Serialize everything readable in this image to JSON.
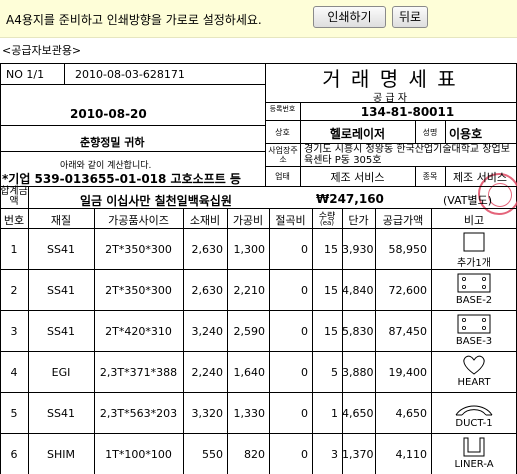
{
  "banner": {
    "message": "A4용지를 준비하고 인쇄방향을 가로로 설정하세요.",
    "print_button": "인쇄하기",
    "back_button": "뒤로"
  },
  "copy_label": "<공급자보관용>",
  "header": {
    "no": "NO 1/1",
    "doc_number": "2010-08-03-628171",
    "title": "거 래 명 세 표",
    "date": "2010-08-20",
    "recipient": "춘향정밀 귀하",
    "calc_notice": "아래와 같이 계산합니다.",
    "bank_account": "*기업 539-013655-01-018 고호소프트 등",
    "supplier_label": "공 급 자",
    "reg_label": "등록번호",
    "reg_number": "134-81-80011",
    "company_label": "상호",
    "company_name": "헬로레이저",
    "ceo_label": "성명",
    "ceo_name": "이용호",
    "address_label": "사업장주소",
    "address": "경기도 시흥시 정왕동 한국산업기술대학교 창업보육센타 P동 305호",
    "type_label": "업태",
    "type_value": "제조 서비스",
    "item_label": "종목",
    "item_value": "제조 서비스"
  },
  "total": {
    "label": "합계금액",
    "korean": "일금 이십사만 칠천일백육십원",
    "amount": "₩247,160",
    "vat": "(VAT별도)"
  },
  "columns": [
    "번호",
    "재질",
    "가공품사이즈",
    "소재비",
    "가공비",
    "절곡비",
    "수량",
    "단가",
    "공급가액",
    "비고"
  ],
  "qty_unit": "(ea)",
  "rows": [
    {
      "no": "1",
      "material": "SS41",
      "size": "2T*350*300",
      "mat_cost": "2,630",
      "proc_cost": "1,300",
      "bend_cost": "0",
      "qty": "15",
      "unit_price": "3,930",
      "supply": "58,950",
      "note": "추가1개",
      "icon": "square-outline-icon"
    },
    {
      "no": "2",
      "material": "SS41",
      "size": "2T*350*300",
      "mat_cost": "2,630",
      "proc_cost": "2,210",
      "bend_cost": "0",
      "qty": "15",
      "unit_price": "4,840",
      "supply": "72,600",
      "note": "BASE-2",
      "icon": "base-plate-holes-icon"
    },
    {
      "no": "3",
      "material": "SS41",
      "size": "2T*420*310",
      "mat_cost": "3,240",
      "proc_cost": "2,590",
      "bend_cost": "0",
      "qty": "15",
      "unit_price": "5,830",
      "supply": "87,450",
      "note": "BASE-3",
      "icon": "base-plate-holes-icon"
    },
    {
      "no": "4",
      "material": "EGI",
      "size": "2,3T*371*388",
      "mat_cost": "2,240",
      "proc_cost": "1,640",
      "bend_cost": "0",
      "qty": "5",
      "unit_price": "3,880",
      "supply": "19,400",
      "note": "HEART",
      "icon": "heart-outline-icon"
    },
    {
      "no": "5",
      "material": "SS41",
      "size": "2,3T*563*203",
      "mat_cost": "3,320",
      "proc_cost": "1,330",
      "bend_cost": "0",
      "qty": "1",
      "unit_price": "4,650",
      "supply": "4,650",
      "note": "DUCT-1",
      "icon": "duct-arc-icon"
    },
    {
      "no": "6",
      "material": "SHIM",
      "size": "1T*100*100",
      "mat_cost": "550",
      "proc_cost": "820",
      "bend_cost": "0",
      "qty": "3",
      "unit_price": "1,370",
      "supply": "4,110",
      "note": "LINER-A",
      "icon": "liner-bracket-icon"
    }
  ]
}
